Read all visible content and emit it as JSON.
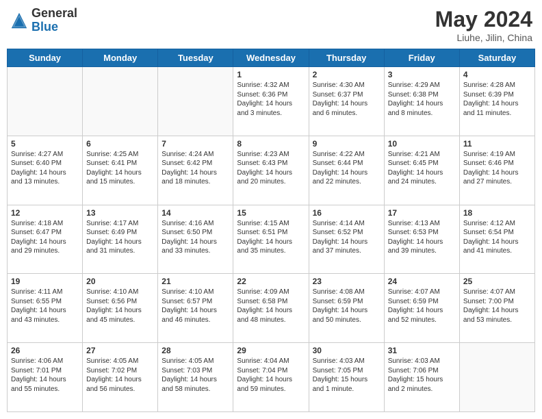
{
  "header": {
    "logo_general": "General",
    "logo_blue": "Blue",
    "month_title": "May 2024",
    "location": "Liuhe, Jilin, China"
  },
  "days_of_week": [
    "Sunday",
    "Monday",
    "Tuesday",
    "Wednesday",
    "Thursday",
    "Friday",
    "Saturday"
  ],
  "weeks": [
    [
      {
        "day": "",
        "content": ""
      },
      {
        "day": "",
        "content": ""
      },
      {
        "day": "",
        "content": ""
      },
      {
        "day": "1",
        "content": "Sunrise: 4:32 AM\nSunset: 6:36 PM\nDaylight: 14 hours\nand 3 minutes."
      },
      {
        "day": "2",
        "content": "Sunrise: 4:30 AM\nSunset: 6:37 PM\nDaylight: 14 hours\nand 6 minutes."
      },
      {
        "day": "3",
        "content": "Sunrise: 4:29 AM\nSunset: 6:38 PM\nDaylight: 14 hours\nand 8 minutes."
      },
      {
        "day": "4",
        "content": "Sunrise: 4:28 AM\nSunset: 6:39 PM\nDaylight: 14 hours\nand 11 minutes."
      }
    ],
    [
      {
        "day": "5",
        "content": "Sunrise: 4:27 AM\nSunset: 6:40 PM\nDaylight: 14 hours\nand 13 minutes."
      },
      {
        "day": "6",
        "content": "Sunrise: 4:25 AM\nSunset: 6:41 PM\nDaylight: 14 hours\nand 15 minutes."
      },
      {
        "day": "7",
        "content": "Sunrise: 4:24 AM\nSunset: 6:42 PM\nDaylight: 14 hours\nand 18 minutes."
      },
      {
        "day": "8",
        "content": "Sunrise: 4:23 AM\nSunset: 6:43 PM\nDaylight: 14 hours\nand 20 minutes."
      },
      {
        "day": "9",
        "content": "Sunrise: 4:22 AM\nSunset: 6:44 PM\nDaylight: 14 hours\nand 22 minutes."
      },
      {
        "day": "10",
        "content": "Sunrise: 4:21 AM\nSunset: 6:45 PM\nDaylight: 14 hours\nand 24 minutes."
      },
      {
        "day": "11",
        "content": "Sunrise: 4:19 AM\nSunset: 6:46 PM\nDaylight: 14 hours\nand 27 minutes."
      }
    ],
    [
      {
        "day": "12",
        "content": "Sunrise: 4:18 AM\nSunset: 6:47 PM\nDaylight: 14 hours\nand 29 minutes."
      },
      {
        "day": "13",
        "content": "Sunrise: 4:17 AM\nSunset: 6:49 PM\nDaylight: 14 hours\nand 31 minutes."
      },
      {
        "day": "14",
        "content": "Sunrise: 4:16 AM\nSunset: 6:50 PM\nDaylight: 14 hours\nand 33 minutes."
      },
      {
        "day": "15",
        "content": "Sunrise: 4:15 AM\nSunset: 6:51 PM\nDaylight: 14 hours\nand 35 minutes."
      },
      {
        "day": "16",
        "content": "Sunrise: 4:14 AM\nSunset: 6:52 PM\nDaylight: 14 hours\nand 37 minutes."
      },
      {
        "day": "17",
        "content": "Sunrise: 4:13 AM\nSunset: 6:53 PM\nDaylight: 14 hours\nand 39 minutes."
      },
      {
        "day": "18",
        "content": "Sunrise: 4:12 AM\nSunset: 6:54 PM\nDaylight: 14 hours\nand 41 minutes."
      }
    ],
    [
      {
        "day": "19",
        "content": "Sunrise: 4:11 AM\nSunset: 6:55 PM\nDaylight: 14 hours\nand 43 minutes."
      },
      {
        "day": "20",
        "content": "Sunrise: 4:10 AM\nSunset: 6:56 PM\nDaylight: 14 hours\nand 45 minutes."
      },
      {
        "day": "21",
        "content": "Sunrise: 4:10 AM\nSunset: 6:57 PM\nDaylight: 14 hours\nand 46 minutes."
      },
      {
        "day": "22",
        "content": "Sunrise: 4:09 AM\nSunset: 6:58 PM\nDaylight: 14 hours\nand 48 minutes."
      },
      {
        "day": "23",
        "content": "Sunrise: 4:08 AM\nSunset: 6:59 PM\nDaylight: 14 hours\nand 50 minutes."
      },
      {
        "day": "24",
        "content": "Sunrise: 4:07 AM\nSunset: 6:59 PM\nDaylight: 14 hours\nand 52 minutes."
      },
      {
        "day": "25",
        "content": "Sunrise: 4:07 AM\nSunset: 7:00 PM\nDaylight: 14 hours\nand 53 minutes."
      }
    ],
    [
      {
        "day": "26",
        "content": "Sunrise: 4:06 AM\nSunset: 7:01 PM\nDaylight: 14 hours\nand 55 minutes."
      },
      {
        "day": "27",
        "content": "Sunrise: 4:05 AM\nSunset: 7:02 PM\nDaylight: 14 hours\nand 56 minutes."
      },
      {
        "day": "28",
        "content": "Sunrise: 4:05 AM\nSunset: 7:03 PM\nDaylight: 14 hours\nand 58 minutes."
      },
      {
        "day": "29",
        "content": "Sunrise: 4:04 AM\nSunset: 7:04 PM\nDaylight: 14 hours\nand 59 minutes."
      },
      {
        "day": "30",
        "content": "Sunrise: 4:03 AM\nSunset: 7:05 PM\nDaylight: 15 hours\nand 1 minute."
      },
      {
        "day": "31",
        "content": "Sunrise: 4:03 AM\nSunset: 7:06 PM\nDaylight: 15 hours\nand 2 minutes."
      },
      {
        "day": "",
        "content": ""
      }
    ]
  ]
}
